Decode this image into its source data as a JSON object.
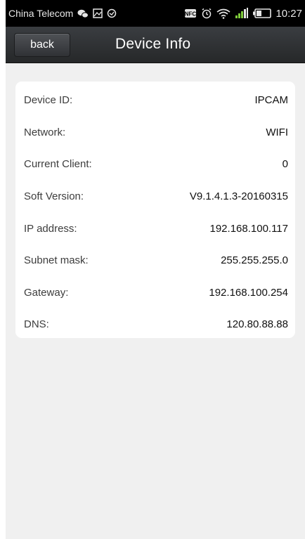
{
  "status_bar": {
    "carrier": "China Telecom",
    "time": "10:27",
    "left_icons": [
      "wechat-icon",
      "image-icon",
      "mail-icon"
    ],
    "right_icons": [
      "nfc-icon",
      "alarm-icon",
      "wifi-icon",
      "signal-icon",
      "battery-icon"
    ],
    "nfc_text": "NFC"
  },
  "header": {
    "back_label": "back",
    "title": "Device Info",
    "colors": {
      "bar": "#2d2f32",
      "text": "#ffffff"
    }
  },
  "device_info": {
    "rows": [
      {
        "label": "Device ID:",
        "value": "IPCAM"
      },
      {
        "label": "Network:",
        "value": "WIFI"
      },
      {
        "label": "Current Client:",
        "value": "0"
      },
      {
        "label": "Soft Version:",
        "value": "V9.1.4.1.3-20160315"
      },
      {
        "label": "IP address:",
        "value": "192.168.100.117"
      },
      {
        "label": "Subnet mask:",
        "value": "255.255.255.0"
      },
      {
        "label": "Gateway:",
        "value": "192.168.100.254"
      },
      {
        "label": "DNS:",
        "value": "120.80.88.88"
      }
    ]
  },
  "colors": {
    "background": "#f0f0f0",
    "card": "#ffffff",
    "status_bar": "#000000"
  }
}
